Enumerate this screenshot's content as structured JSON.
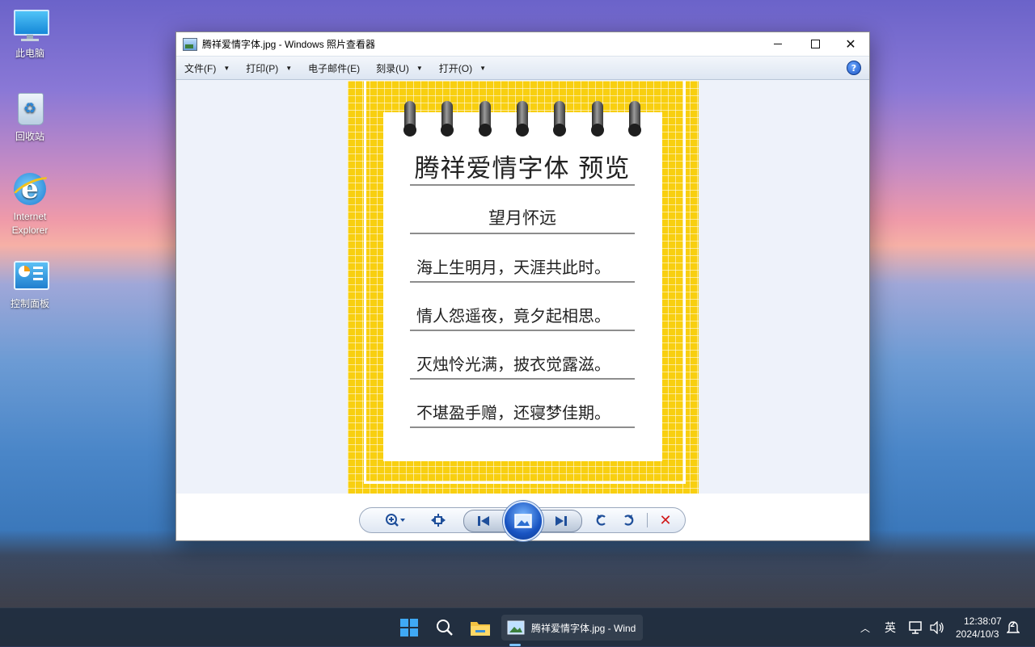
{
  "desktop": {
    "icons": [
      {
        "label": "此电脑"
      },
      {
        "label": "回收站"
      },
      {
        "label": "Internet Explorer"
      },
      {
        "label": "控制面板"
      }
    ]
  },
  "window": {
    "title": "腾祥爱情字体.jpg - Windows 照片查看器",
    "menu": [
      {
        "label": "文件(F)",
        "has_caret": true
      },
      {
        "label": "打印(P)",
        "has_caret": true
      },
      {
        "label": "电子邮件(E)",
        "has_caret": false
      },
      {
        "label": "刻录(U)",
        "has_caret": true
      },
      {
        "label": "打开(O)",
        "has_caret": true
      }
    ],
    "help_label": "?"
  },
  "image": {
    "title": "腾祥爱情字体  预览",
    "subtitle": "望月怀远",
    "lines": [
      "海上生明月，天涯共此时。",
      "情人怨遥夜，竟夕起相思。",
      "灭烛怜光满，披衣觉露滋。",
      "不堪盈手赠，还寝梦佳期。"
    ],
    "background_color": "#f8cf10"
  },
  "taskbar": {
    "active_app_label": "腾祥爱情字体.jpg - Windows 照片查看器",
    "ime": "英",
    "time": "12:38:07",
    "date": "2024/10/3",
    "notification_count": "2"
  },
  "colors": {
    "accent": "#1f4f9a",
    "delete": "#d11a1a"
  }
}
